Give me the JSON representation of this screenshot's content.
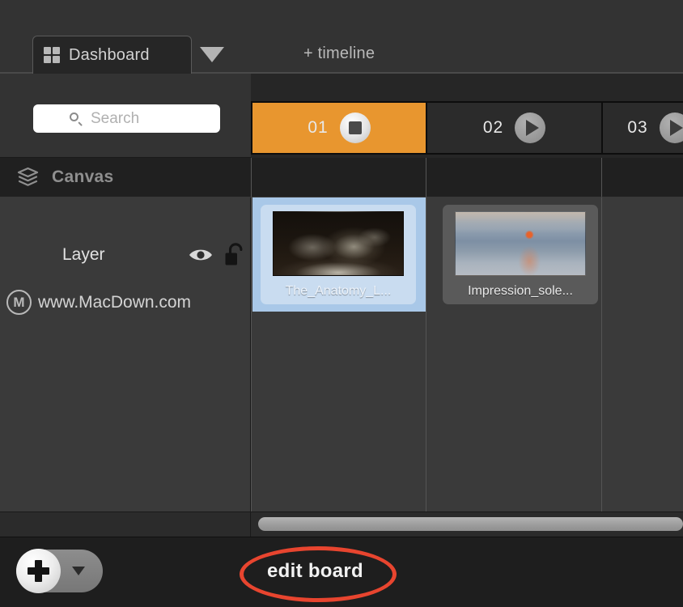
{
  "window": {
    "background": "#2b2b2b"
  },
  "tabbar": {
    "active_tab": {
      "label": "Dashboard",
      "icon": "grid-icon"
    },
    "dropdown_icon": "caret-down-icon",
    "add_timeline_label": "+ timeline"
  },
  "sidebar": {
    "search": {
      "placeholder": "Search",
      "value": "",
      "icon": "search-icon"
    },
    "canvas_header": {
      "label": "Canvas",
      "icon": "layers-icon"
    },
    "layer": {
      "name": "Layer",
      "visibility_icon": "eye-icon",
      "lock_icon": "unlock-icon"
    }
  },
  "timeline": {
    "columns": [
      {
        "number": "01",
        "state": "active",
        "transport_icon": "stop-icon",
        "accent": "#e8962f"
      },
      {
        "number": "02",
        "state": "inactive",
        "transport_icon": "play-icon",
        "accent": "#2b2b2b"
      },
      {
        "number": "03",
        "state": "inactive",
        "transport_icon": "play-icon",
        "accent": "#2b2b2b"
      }
    ],
    "cells": [
      {
        "column": "01",
        "selected": true,
        "thumbnail": {
          "caption": "The_Anatomy_L...",
          "artwork": "the-anatomy-lesson"
        }
      },
      {
        "column": "02",
        "selected": false,
        "thumbnail": {
          "caption": "Impression_sole...",
          "artwork": "impression-sunrise"
        }
      }
    ],
    "scrollbar": {
      "orientation": "horizontal",
      "position": "start"
    }
  },
  "bottombar": {
    "add_button": {
      "icon": "plus-icon",
      "dropdown_icon": "caret-down-icon"
    },
    "edit_board_label": "edit board",
    "annotation": {
      "shape": "ellipse",
      "color": "#e8452f"
    }
  },
  "watermark": {
    "logo_letter": "M",
    "text": "www.MacDown.com"
  }
}
